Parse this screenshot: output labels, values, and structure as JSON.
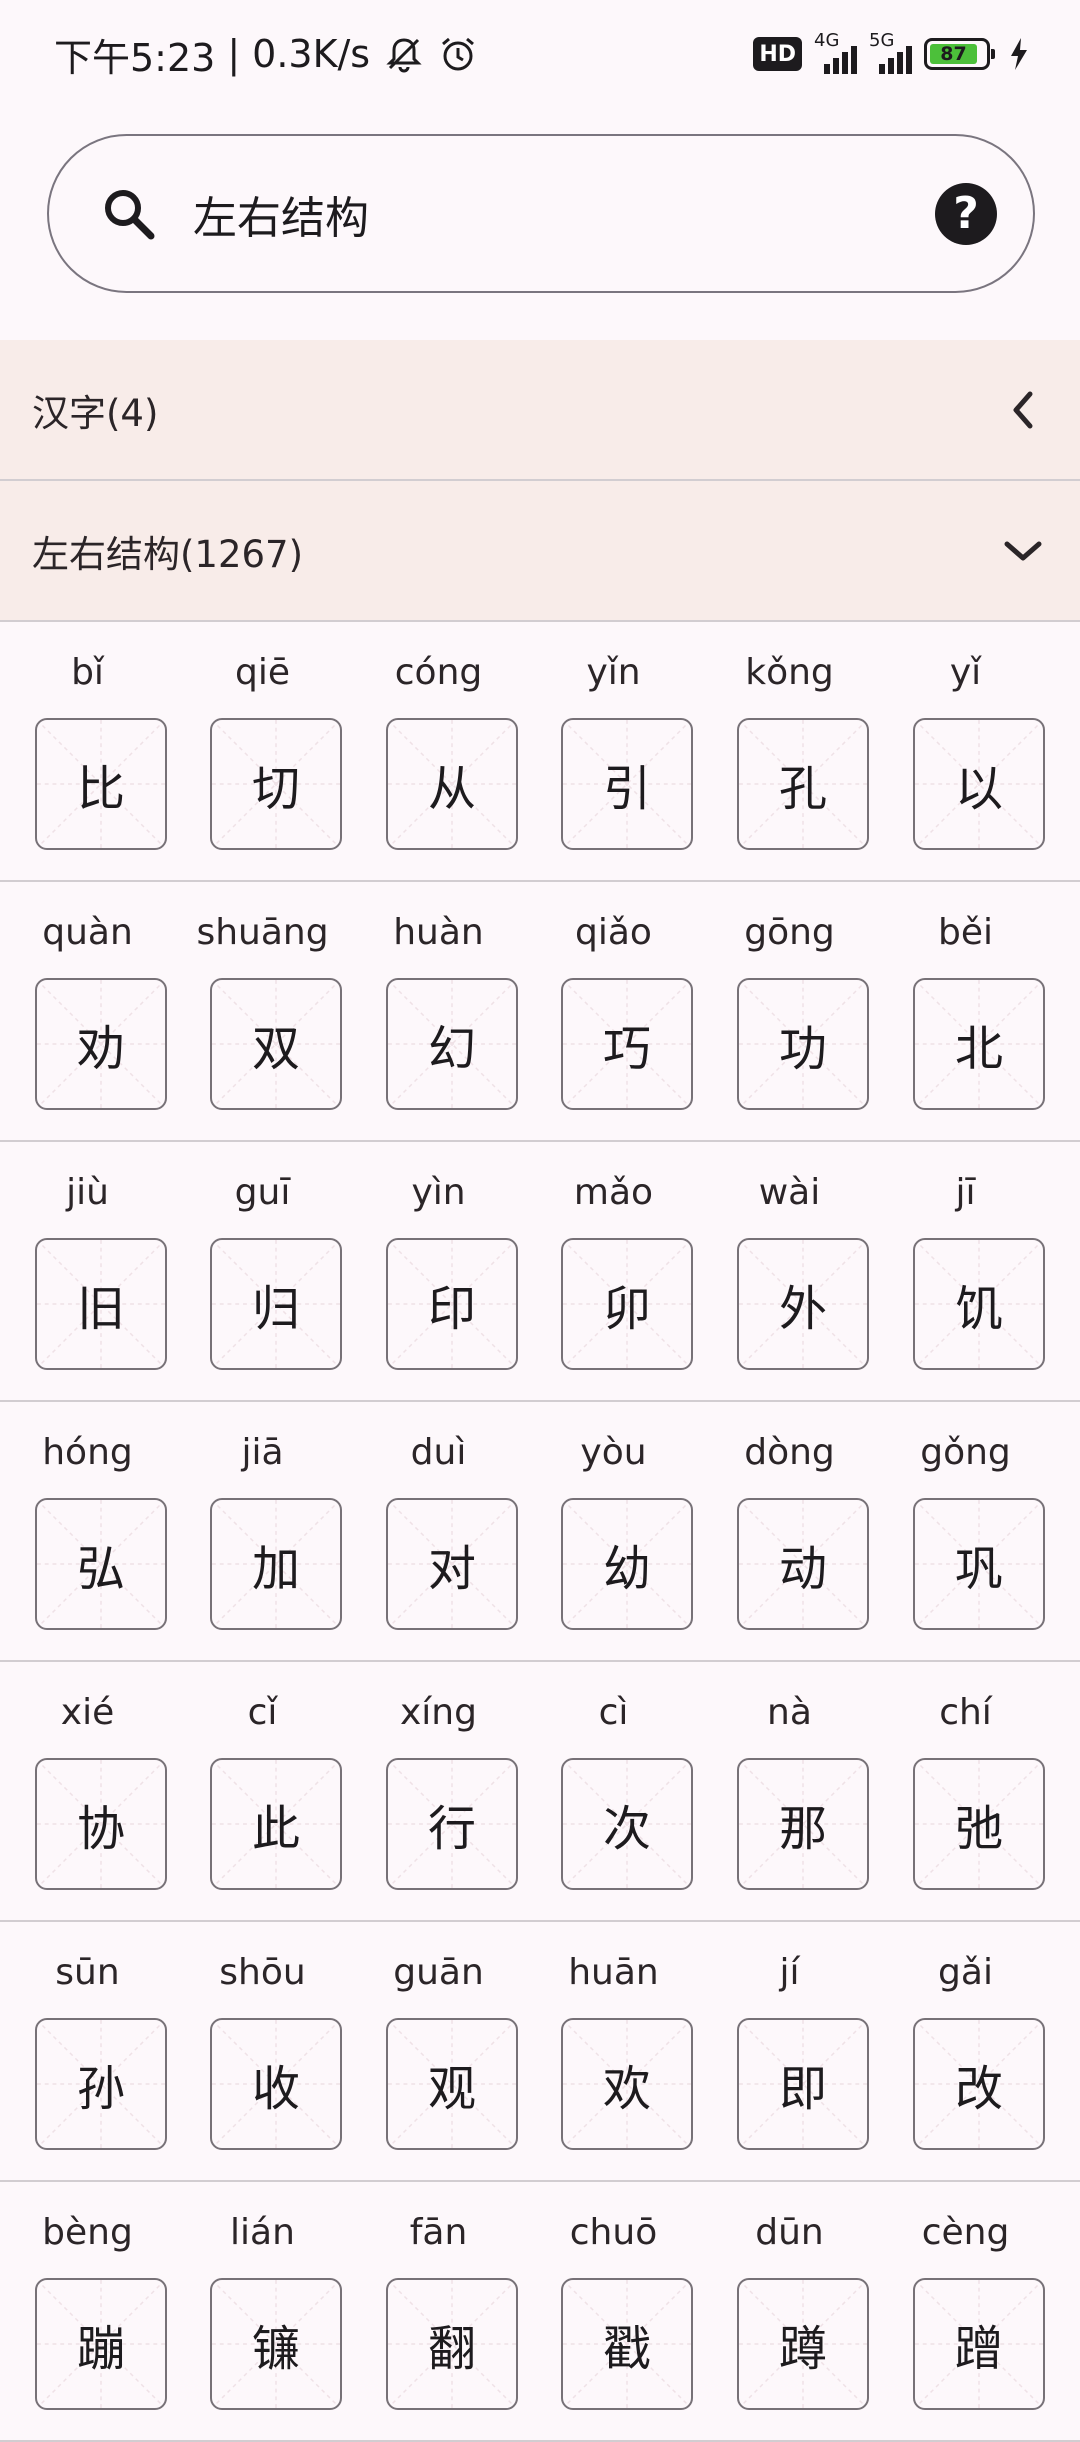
{
  "status_bar": {
    "time": "下午5:23",
    "speed": "0.3K/s",
    "network_1": "4G",
    "network_2": "5G",
    "hd_label": "HD",
    "battery": "87"
  },
  "search": {
    "value": "左右结构",
    "placeholder": ""
  },
  "sections": [
    {
      "label": "汉字(4)",
      "chevron": "chevron-left-icon"
    },
    {
      "label": "左右结构(1267)",
      "chevron": "chevron-down-icon"
    }
  ],
  "characters": [
    [
      {
        "pinyin": "bǐ",
        "char": "比"
      },
      {
        "pinyin": "qiē",
        "char": "切"
      },
      {
        "pinyin": "cóng",
        "char": "从"
      },
      {
        "pinyin": "yǐn",
        "char": "引"
      },
      {
        "pinyin": "kǒng",
        "char": "孔"
      },
      {
        "pinyin": "yǐ",
        "char": "以"
      }
    ],
    [
      {
        "pinyin": "quàn",
        "char": "劝"
      },
      {
        "pinyin": "shuāng",
        "char": "双"
      },
      {
        "pinyin": "huàn",
        "char": "幻"
      },
      {
        "pinyin": "qiǎo",
        "char": "巧"
      },
      {
        "pinyin": "gōng",
        "char": "功"
      },
      {
        "pinyin": "běi",
        "char": "北"
      }
    ],
    [
      {
        "pinyin": "jiù",
        "char": "旧"
      },
      {
        "pinyin": "guī",
        "char": "归"
      },
      {
        "pinyin": "yìn",
        "char": "印"
      },
      {
        "pinyin": "mǎo",
        "char": "卯"
      },
      {
        "pinyin": "wài",
        "char": "外"
      },
      {
        "pinyin": "jī",
        "char": "饥"
      }
    ],
    [
      {
        "pinyin": "hóng",
        "char": "弘"
      },
      {
        "pinyin": "jiā",
        "char": "加"
      },
      {
        "pinyin": "duì",
        "char": "对"
      },
      {
        "pinyin": "yòu",
        "char": "幼"
      },
      {
        "pinyin": "dòng",
        "char": "动"
      },
      {
        "pinyin": "gǒng",
        "char": "巩"
      }
    ],
    [
      {
        "pinyin": "xié",
        "char": "协"
      },
      {
        "pinyin": "cǐ",
        "char": "此"
      },
      {
        "pinyin": "xíng",
        "char": "行"
      },
      {
        "pinyin": "cì",
        "char": "次"
      },
      {
        "pinyin": "nà",
        "char": "那"
      },
      {
        "pinyin": "chí",
        "char": "弛"
      }
    ],
    [
      {
        "pinyin": "sūn",
        "char": "孙"
      },
      {
        "pinyin": "shōu",
        "char": "收"
      },
      {
        "pinyin": "guān",
        "char": "观"
      },
      {
        "pinyin": "huān",
        "char": "欢"
      },
      {
        "pinyin": "jí",
        "char": "即"
      },
      {
        "pinyin": "gǎi",
        "char": "改"
      }
    ],
    [
      {
        "pinyin": "bèng",
        "char": "蹦"
      },
      {
        "pinyin": "lián",
        "char": "镰"
      },
      {
        "pinyin": "fān",
        "char": "翻"
      },
      {
        "pinyin": "chuō",
        "char": "戳"
      },
      {
        "pinyin": "dūn",
        "char": "蹲"
      },
      {
        "pinyin": "cèng",
        "char": "蹭"
      }
    ]
  ]
}
